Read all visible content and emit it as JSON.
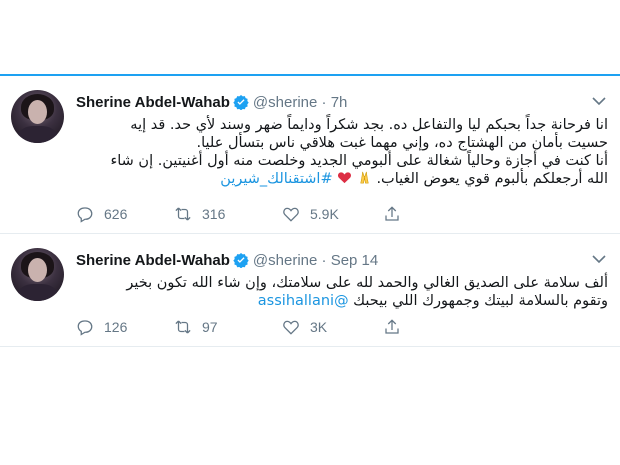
{
  "tweets": [
    {
      "name": "Sherine Abdel-Wahab",
      "handle": "@sherine",
      "separator": "·",
      "time": "7h",
      "lines": [
        "انا فرحانة جداً بحبكم ليا والتفاعل ده. بجد شكراً ودايماً ضهر وسند لأي حد. قد إيه",
        "حسيت بأمان من الهشتاج ده، وإني مهما غبت هلاقي ناس بتسأل عليا.",
        "أنا كنت في أجازة وحالياً شغالة على ألبومي الجديد وخلصت منه أول أغنيتين. إن شاء",
        "الله أرجعلكم بألبوم قوي يعوض الغياب."
      ],
      "hashtag": "#اشتقنالك_شيرين",
      "reply_count": "626",
      "retweet_count": "316",
      "like_count": "5.9K"
    },
    {
      "name": "Sherine Abdel-Wahab",
      "handle": "@sherine",
      "separator": "·",
      "time": "Sep 14",
      "lines": [
        "ألف سلامة على الصديق الغالي والحمد لله على سلامتك، وإن شاء الله تكون بخير",
        "وتقوم بالسلامة لبيتك وجمهورك اللي بيحبك"
      ],
      "mention": "@assihallani",
      "reply_count": "126",
      "retweet_count": "97",
      "like_count": "3K"
    }
  ],
  "icons": {
    "verified": "verified-badge-icon",
    "menu": "chevron-down-icon",
    "reply": "reply-icon",
    "retweet": "retweet-icon",
    "like": "heart-icon",
    "share": "share-icon",
    "emoji_pray": "praying-hands-emoji",
    "emoji_heart": "red-heart-emoji"
  },
  "colors": {
    "accent": "#1da1f2",
    "link": "#1b95e0",
    "meta": "#657786",
    "heart": "#e0245e"
  }
}
